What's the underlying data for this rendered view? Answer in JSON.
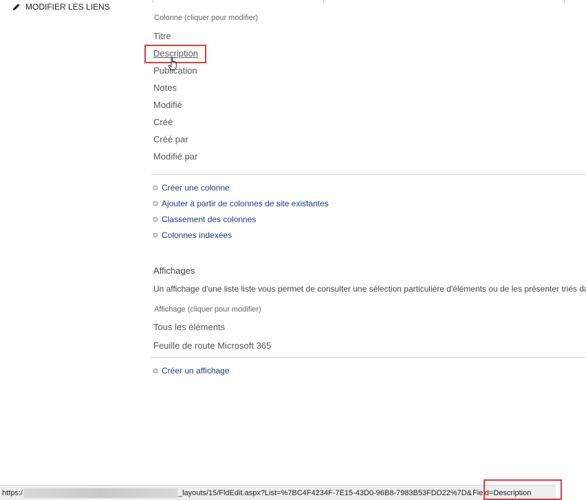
{
  "sidebar": {
    "edit_links_label": "MODIFIER LES LIENS"
  },
  "columns": {
    "label": "Colonne (cliquer pour modifier)",
    "items": [
      "Titre",
      "Description",
      "Publication",
      "Notes",
      "Modifié",
      "Créé",
      "Créé par",
      "Modifié par"
    ],
    "hovered_item": "Description"
  },
  "column_links": [
    "Créer une colonne",
    "Ajouter à partir de colonnes de site existantes",
    "Classement des colonnes",
    "Colonnes indexées"
  ],
  "views": {
    "heading": "Affichages",
    "description": "Un affichage d'une liste liste vous permet de consulter une sélection particulière d'éléments ou de les présenter triés dans",
    "label": "Affichage (cliquer pour modifier)",
    "items": [
      "Tous les éléments",
      "Feuille de route Microsoft 365"
    ],
    "create_link": "Créer un affichage"
  },
  "status_bar": {
    "url_start": "https:/",
    "url_rest": "_layouts/15/FldEdit.aspx?List=%7BC4F4234F-7E15-43D0-96B8-7983B53FDD22%7D&",
    "url_field": "Field=Description"
  },
  "colors": {
    "highlight": "#e03a3a",
    "link": "#1a3c78"
  }
}
